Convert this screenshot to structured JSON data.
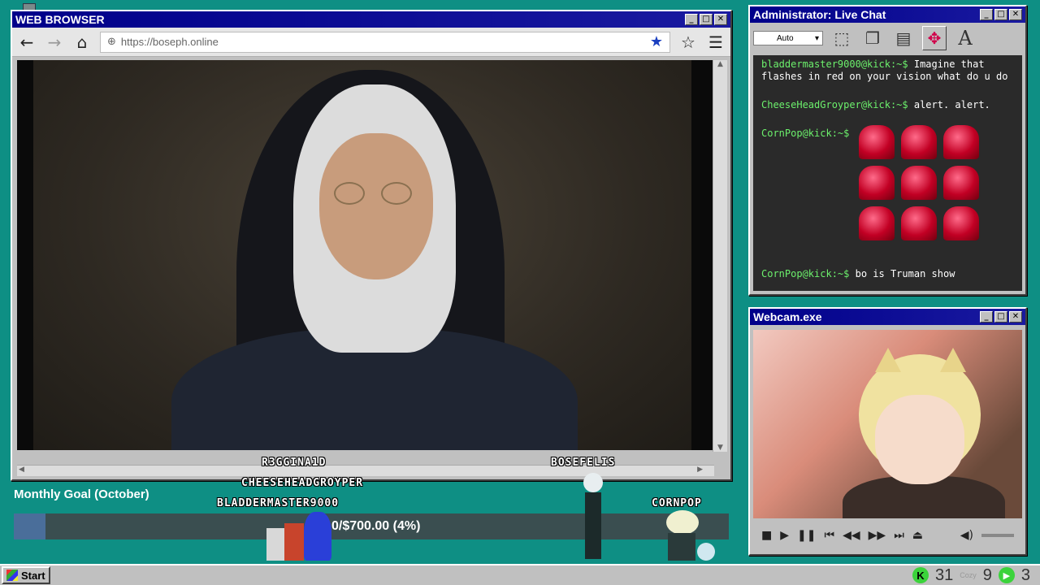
{
  "browser": {
    "title": "WEB BROWSER",
    "url": "https://boseph.online"
  },
  "chat": {
    "title": "Administrator: Live Chat",
    "select_value": "Auto",
    "messages": [
      {
        "user": "bladdermaster9000@kick:~$",
        "text": "Imagine that flashes in red on your vision what do u do"
      },
      {
        "user": "CheeseHeadGroyper@kick:~$",
        "text": "alert. alert."
      },
      {
        "user": "CornPop@kick:~$",
        "text": ""
      },
      {
        "user": "CornPop@kick:~$",
        "text": "bo is Truman show"
      }
    ],
    "alert_emote_count": 9
  },
  "webcam": {
    "title": "Webcam.exe"
  },
  "goal": {
    "title": "Monthly Goal (October)",
    "text": "0/$700.00 (4%)",
    "progress": 0.04
  },
  "sprites": {
    "r3gginald": "R3GGINA1D",
    "cheese": "CHEESEHEADGROYPER",
    "bladder": "BLADDERMASTER9000",
    "bosefelis": "BOSEFELIS",
    "cornpop": "CORNPOP"
  },
  "taskbar": {
    "start": "Start",
    "tray_a": "31",
    "tray_cozy": "Cozy",
    "tray_b": "9",
    "tray_c": "3"
  },
  "colors": {
    "desktop": "#0e8f84",
    "title_bar": "#00008a",
    "chat_user": "#6cf06c"
  }
}
